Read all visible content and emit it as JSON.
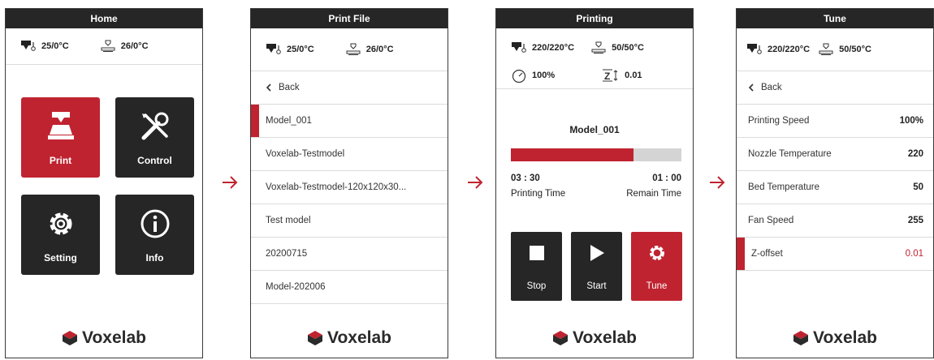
{
  "screens": {
    "home": {
      "title": "Home",
      "nozzle_temp": "25/0°C",
      "bed_temp": "26/0°C",
      "tiles": [
        "Print",
        "Control",
        "Setting",
        "Info"
      ],
      "brand": "Voxelab"
    },
    "print_file": {
      "title": "Print File",
      "nozzle_temp": "25/0°C",
      "bed_temp": "26/0°C",
      "back": "Back",
      "files": [
        "Model_001",
        "Voxelab-Testmodel",
        "Voxelab-Testmodel-120x120x30...",
        "Test model",
        "20200715",
        "Model-202006"
      ],
      "brand": "Voxelab"
    },
    "printing": {
      "title": "Printing",
      "nozzle_temp": "220/220°C",
      "bed_temp": "50/50°C",
      "speed": "100%",
      "z_offset": "0.01",
      "file_name": "Model_001",
      "progress": 0.72,
      "printing_time": "03 : 30",
      "printing_time_label": "Printing Time",
      "remain_time": "01 : 00",
      "remain_time_label": "Remain Time",
      "buttons": [
        "Stop",
        "Start",
        "Tune"
      ],
      "brand": "Voxelab"
    },
    "tune": {
      "title": "Tune",
      "nozzle_temp": "220/220°C",
      "bed_temp": "50/50°C",
      "back": "Back",
      "rows": [
        {
          "label": "Printing Speed",
          "value": "100%"
        },
        {
          "label": "Nozzle Temperature",
          "value": "220"
        },
        {
          "label": "Bed Temperature",
          "value": "50"
        },
        {
          "label": "Fan Speed",
          "value": "255"
        },
        {
          "label": "Z-offset",
          "value": "0.01"
        }
      ],
      "brand": "Voxelab"
    }
  },
  "colors": {
    "accent_red": "#c02330",
    "dark_tile": "#262626"
  },
  "icons": [
    "nozzle-icon",
    "bed-icon",
    "arrow-right-icon",
    "speedometer-icon",
    "z-offset-icon",
    "chevron-left-icon",
    "voxelab-logo-icon"
  ]
}
